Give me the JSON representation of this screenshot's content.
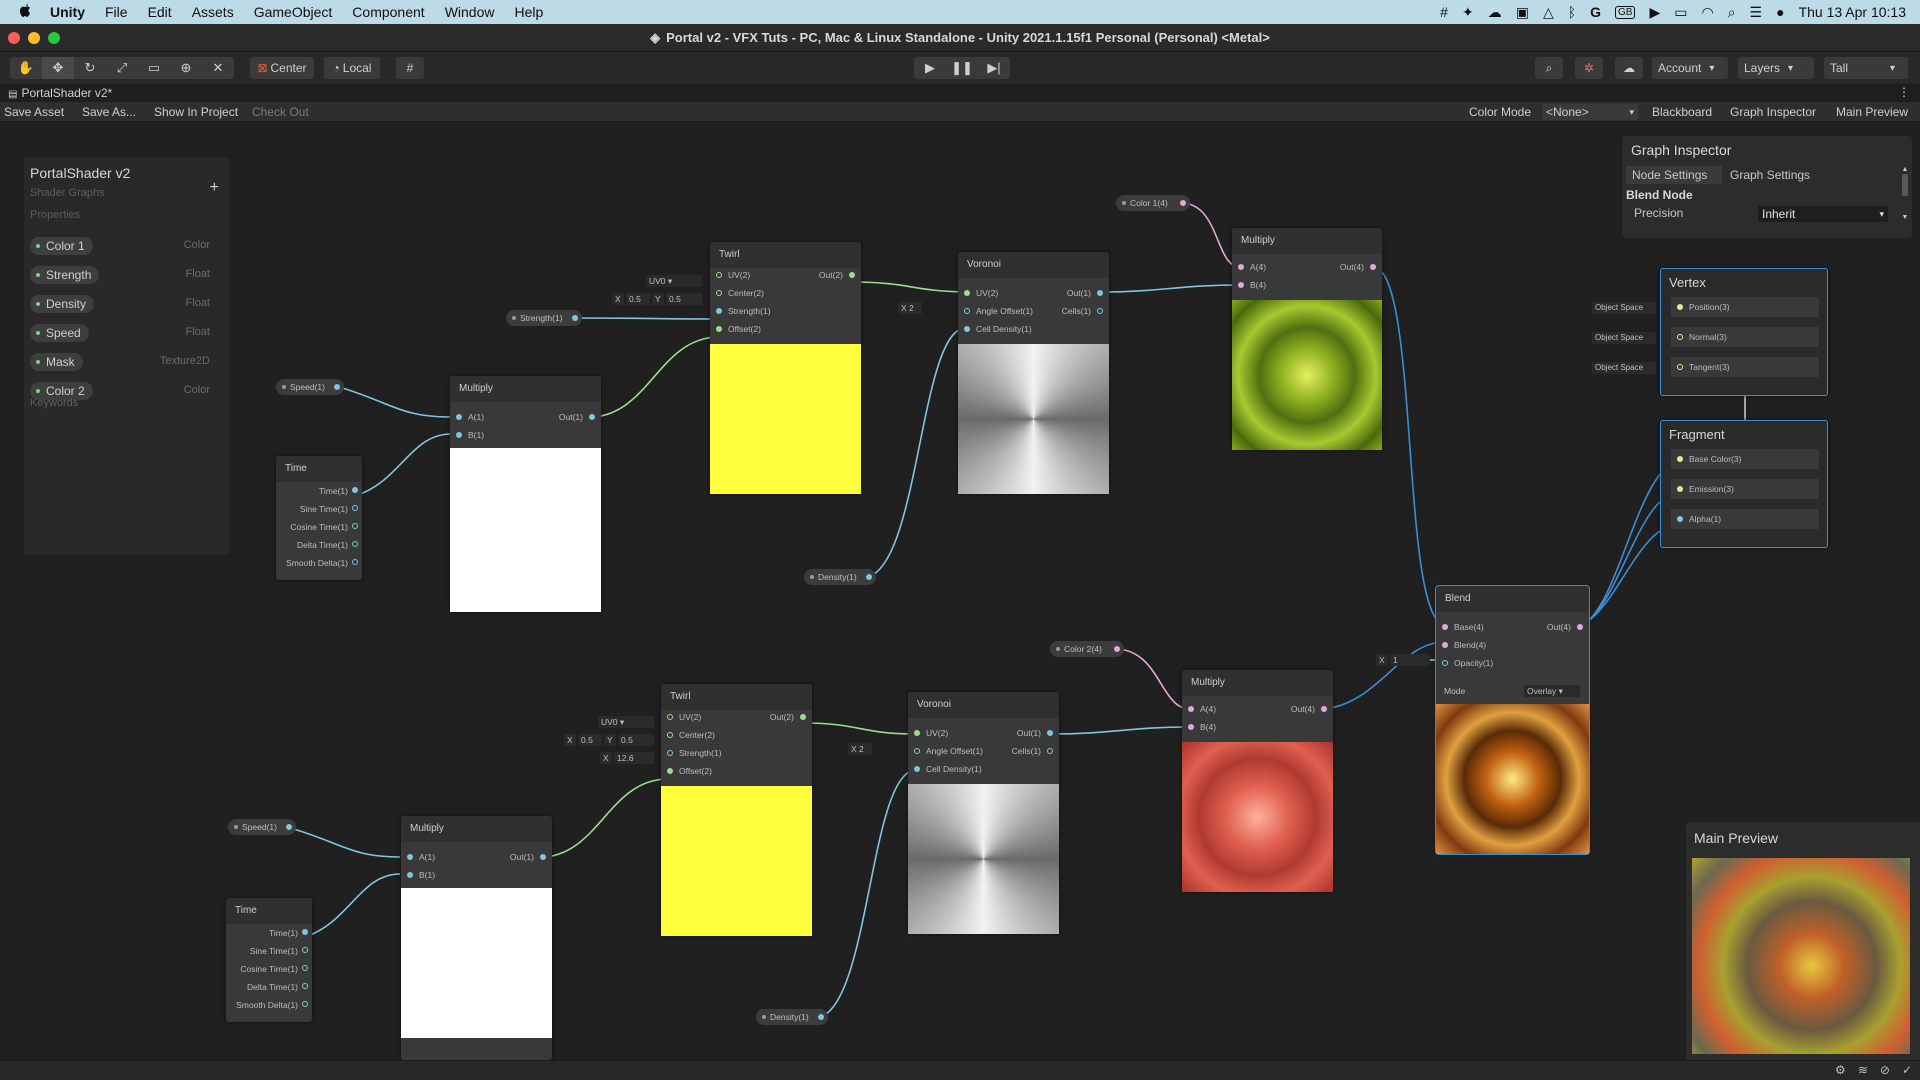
{
  "menubar": {
    "items": [
      "Unity",
      "File",
      "Edit",
      "Assets",
      "GameObject",
      "Component",
      "Window",
      "Help"
    ],
    "date_time": "Thu 13 Apr  10:13"
  },
  "window": {
    "title": "Portal v2 - VFX Tuts - PC, Mac & Linux Standalone - Unity 2021.1.15f1 Personal (Personal) <Metal>"
  },
  "toolbar": {
    "center": "Center",
    "local": "Local",
    "account": "Account",
    "layers": "Layers",
    "layout": "Tall"
  },
  "tab": {
    "title": "PortalShader v2*"
  },
  "graphbar": {
    "save_asset": "Save Asset",
    "save_as": "Save As...",
    "show_in_project": "Show In Project",
    "check_out": "Check Out",
    "color_mode_label": "Color Mode",
    "color_mode_value": "<None>",
    "blackboard": "Blackboard",
    "graph_inspector": "Graph Inspector",
    "main_preview": "Main Preview"
  },
  "blackboard": {
    "title": "PortalShader v2",
    "subtitle": "Shader Graphs",
    "properties_label": "Properties",
    "keywords_label": "Keywords",
    "properties": [
      {
        "name": "Color 1",
        "type": "Color"
      },
      {
        "name": "Strength",
        "type": "Float"
      },
      {
        "name": "Density",
        "type": "Float"
      },
      {
        "name": "Speed",
        "type": "Float"
      },
      {
        "name": "Mask",
        "type": "Texture2D"
      },
      {
        "name": "Color 2",
        "type": "Color"
      }
    ]
  },
  "inspector": {
    "title": "Graph Inspector",
    "tab_node": "Node Settings",
    "tab_graph": "Graph Settings",
    "node_title": "Blend Node",
    "precision_label": "Precision",
    "precision_value": "Inherit"
  },
  "nodes": {
    "multiply": {
      "title": "Multiply",
      "a1": "A(1)",
      "b1": "B(1)",
      "out1": "Out(1)",
      "a4": "A(4)",
      "b4": "B(4)",
      "out4": "Out(4)"
    },
    "time": {
      "title": "Time",
      "outputs": [
        "Time(1)",
        "Sine Time(1)",
        "Cosine Time(1)",
        "Delta Time(1)",
        "Smooth Delta(1)"
      ]
    },
    "twirl": {
      "title": "Twirl",
      "uv": "UV(2)",
      "center": "Center(2)",
      "strength": "Strength(1)",
      "offset": "Offset(2)",
      "out": "Out(2)",
      "uv_field": "UV0"
    },
    "voronoi": {
      "title": "Voronoi",
      "uv": "UV(2)",
      "angle": "Angle Offset(1)",
      "cell_density": "Cell Density(1)",
      "out": "Out(1)",
      "cells": "Cells(1)"
    },
    "blend": {
      "title": "Blend",
      "base": "Base(4)",
      "blend": "Blend(4)",
      "opacity": "Opacity(1)",
      "out": "Out(4)",
      "mode_label": "Mode",
      "mode_value": "Overlay"
    },
    "vertex": {
      "title": "Vertex",
      "ports": [
        "Position(3)",
        "Normal(3)",
        "Tangent(3)"
      ],
      "space": "Object Space"
    },
    "fragment": {
      "title": "Fragment",
      "ports": [
        "Base Color(3)",
        "Emission(3)",
        "Alpha(1)"
      ]
    }
  },
  "pills": {
    "speed": "Speed(1)",
    "strength": "Strength(1)",
    "density": "Density(1)",
    "color1": "Color 1(4)",
    "color2": "Color 2(4)"
  },
  "fields": {
    "x": "X",
    "y": "Y",
    "center_x": "0.5",
    "center_y": "0.5",
    "angle": "2",
    "opacity": "1",
    "strength_2": "12.6"
  },
  "preview": {
    "title": "Main Preview"
  },
  "colors": {
    "accent_blue": "#3a8fd4",
    "float_wire": "#7fc6e0",
    "vec2_wire": "#9ae08a",
    "vec4_wire": "#e4a8d8",
    "vec3_wire": "#e8e890"
  }
}
